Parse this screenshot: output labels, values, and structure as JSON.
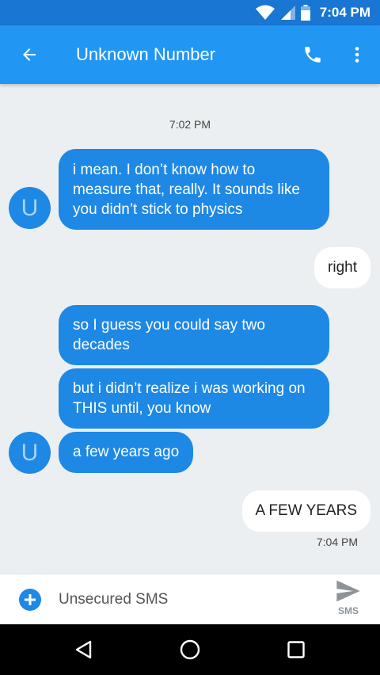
{
  "status_bar": {
    "time": "7:04 PM"
  },
  "header": {
    "title": "Unknown Number"
  },
  "conversation": {
    "timestamp_top": "7:02 PM",
    "timestamp_bottom": "7:04 PM",
    "avatar_letter": "U",
    "messages": [
      {
        "direction": "incoming",
        "text": "i mean. I don’t know how to measure that, really. It sounds like you didn’t stick to physics"
      },
      {
        "direction": "outgoing",
        "text": "right"
      },
      {
        "direction": "incoming",
        "text": "so I guess you could say two decades"
      },
      {
        "direction": "incoming",
        "text": "but i didn’t realize i was working on THIS until, you know"
      },
      {
        "direction": "incoming",
        "text": "a few years ago"
      },
      {
        "direction": "outgoing",
        "text": "A FEW YEARS"
      }
    ]
  },
  "compose": {
    "placeholder": "Unsecured SMS",
    "send_label": "SMS"
  },
  "colors": {
    "status_bar": "#1976d2",
    "app_bar": "#2196f3",
    "incoming_bubble": "#1e88e5",
    "background": "#eceff1"
  },
  "icons": [
    "back-arrow-icon",
    "phone-icon",
    "more-vert-icon",
    "wifi-icon",
    "signal-icon",
    "battery-icon",
    "add-icon",
    "send-icon",
    "nav-back-icon",
    "nav-home-icon",
    "nav-recent-icon"
  ]
}
